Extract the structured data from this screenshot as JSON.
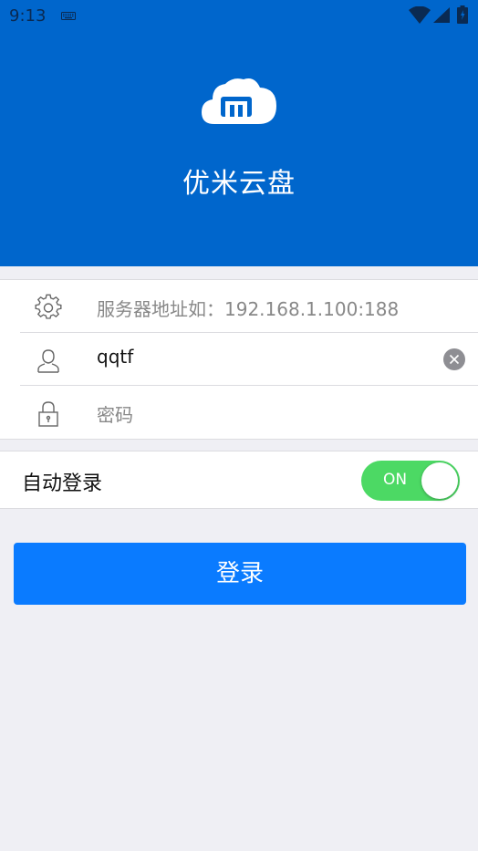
{
  "status_bar": {
    "time": "9:13",
    "icons": [
      "keyboard-icon",
      "wifi-icon",
      "signal-icon",
      "battery-icon"
    ]
  },
  "header": {
    "logo": "cloud-m-logo-icon",
    "app_name": "优米云盘",
    "background_color": "#0066cc"
  },
  "form": {
    "server_field": {
      "icon": "gear-icon",
      "value": "",
      "placeholder": "服务器地址如：192.168.1.100:188"
    },
    "username_field": {
      "icon": "user-icon",
      "value": "qqtf",
      "clear_icon": "clear-icon"
    },
    "password_field": {
      "icon": "lock-icon",
      "value": "",
      "placeholder": "密码"
    }
  },
  "auto_login": {
    "label": "自动登录",
    "toggle_state": "ON",
    "toggle_color": "#4cd964"
  },
  "login_button": {
    "label": "登录",
    "color": "#0a7bff"
  }
}
